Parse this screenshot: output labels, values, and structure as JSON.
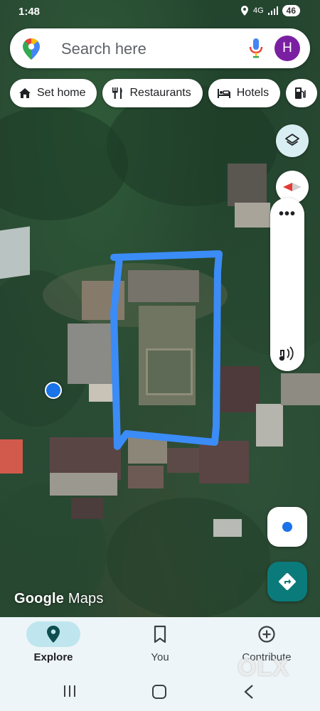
{
  "status_bar": {
    "time": "1:48",
    "network": "4G",
    "battery": "46"
  },
  "search": {
    "placeholder": "Search here",
    "avatar_initial": "H"
  },
  "chips": [
    {
      "label": "Set home",
      "icon": "home-icon"
    },
    {
      "label": "Restaurants",
      "icon": "restaurant-icon"
    },
    {
      "label": "Hotels",
      "icon": "hotel-icon"
    },
    {
      "label": "",
      "icon": "gas-station-icon"
    }
  ],
  "map": {
    "attribution_brand": "Google",
    "attribution_product": "Maps",
    "highlight_color": "#3b8cf6"
  },
  "bottom_nav": [
    {
      "label": "Explore",
      "icon": "explore-pin-icon",
      "active": true
    },
    {
      "label": "You",
      "icon": "bookmark-icon",
      "active": false
    },
    {
      "label": "Contribute",
      "icon": "add-circle-icon",
      "active": false
    }
  ],
  "watermark": "OLX",
  "colors": {
    "accent": "#0b7a7a",
    "user_location": "#1a73e8",
    "avatar": "#7b1fa2"
  }
}
